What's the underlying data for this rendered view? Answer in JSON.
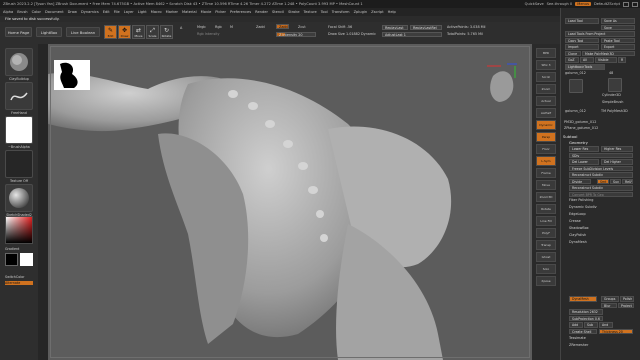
{
  "titlebar": {
    "title": "ZBrush 2023.2.2 [Tyson Yan]   ZBrush Document   • Free Mem 74.675GB • Active Mem 8462 • Scratch Disk 43 • ZTime 10.596 RTime 4.26 Timer 4.272 ATime 1.248 • PolyCount 3.993 MP • MeshCount 1",
    "quicksave": "QuickSave",
    "see_through": "See-through 0",
    "menus": "Menus",
    "default_script": "DefaultZScript"
  },
  "menu": [
    "Alpha",
    "Brush",
    "Color",
    "Document",
    "Draw",
    "Dynamics",
    "Edit",
    "File",
    "Layer",
    "Light",
    "Macro",
    "Marker",
    "Material",
    "Movie",
    "Picker",
    "Preferences",
    "Render",
    "Stencil",
    "Stroke",
    "Texture",
    "Tool",
    "Transform",
    "Zplugin",
    "Zscript",
    "Help"
  ],
  "notice": "File saved to disk successfully.",
  "shelf": {
    "nav": [
      "Home Page",
      "LightBox",
      "Live Boolean"
    ],
    "tools": [
      {
        "icon": "✎",
        "label": "Edit",
        "active": true
      },
      {
        "icon": "✥",
        "label": "Draw",
        "active": true
      },
      {
        "icon": "⇄",
        "label": "Move",
        "active": false
      },
      {
        "icon": "⤢",
        "label": "Scale",
        "active": false
      },
      {
        "icon": "↻",
        "label": "Rotate",
        "active": false
      }
    ],
    "a_label": "A",
    "mrgb": "Mrgb",
    "rgb": "Rgb",
    "m": "M",
    "rgb_intensity": "Rgb Intensity",
    "zadd": "Zadd",
    "zsub": "Zsub",
    "zcut": "Zcut",
    "z_intensity": "Z Intensity 20",
    "z_intensity_value": 20,
    "focal_shift": "Focal Shift -56",
    "draw_size": "Draw Size 1.01882",
    "dynamic": "Dynamic",
    "replay_last": "ReplayLast",
    "replay_last_rel": "ReplayLastRel",
    "adjust_last": "AdjustLast 1",
    "active_points": "ActivePoints: 3.038 Mil",
    "total_points": "TotalPoints: 5.765 Mil"
  },
  "left": {
    "items": [
      {
        "label": "ClayBuildup"
      },
      {
        "label": "FreeHand"
      },
      {
        "label": "~BrushAlpha"
      },
      {
        "label": "Texture Off"
      },
      {
        "label": "SketchShaded2"
      },
      {
        "label": "Gradient"
      },
      {
        "label": "SwitchColor"
      },
      {
        "label": "Alternate"
      }
    ]
  },
  "vptools": [
    "BPR",
    "SPix 3",
    "Scroll",
    "Zoom",
    "Actual",
    "AAHalf",
    "Dynamic",
    "Persp",
    "Floor",
    "L.Sym",
    "Frame",
    "Move",
    "Zoom3D",
    "Rotate",
    "Line Fill",
    "PolyF",
    "Transp",
    "Ghost",
    "Solo",
    "Xpose"
  ],
  "right": {
    "load_tool": "Load Tool",
    "save_as": "Save As",
    "save": "Save",
    "load_tools_from_project": "Load Tools From Project",
    "copy_tool": "Copy Tool",
    "paste_tool": "Paste Tool",
    "import": "Import",
    "export": "Export",
    "clone": "Clone",
    "make_polymesh3d": "Make PolyMesh3D",
    "goz": "GoZ",
    "all": "All",
    "visible": "Visible",
    "r": "R",
    "lightbox_tools": "Lightbox>Tools",
    "current_tool": "golumn_012",
    "current_tool_count": "48",
    "thumbs": [
      "golumn_012",
      "Cylinder3D",
      "SimpleBrush",
      "golumn_012",
      "PM3D_golumn_012",
      "TM PolyMesh3D",
      "ZPlane_golumn_012"
    ],
    "subtool": "Subtool",
    "geometry": "Geometry",
    "lower_res": "Lower Res",
    "higher_res": "Higher Res",
    "sdiv": "SDiv",
    "del_lower": "Del Lower",
    "del_higher": "Del Higher",
    "freeze_subdiv": "Freeze SubDivision Levels",
    "reconstruct_subdiv": "Reconstruct Subdiv",
    "divide": "Divide",
    "smt": "Smt",
    "suv": "Suv",
    "reuv": "ReUV",
    "convert_bpr": "Convert BPR To Geo",
    "edge_loop": "EdgeLoop",
    "crease": "Crease",
    "shadowbox": "ShadowBox",
    "claypolish": "ClayPolish",
    "dynamesh": "DynaMesh",
    "groups": "Groups",
    "polish": "Polish",
    "blur": "Blur",
    "project": "Project",
    "resolution": "Resolution 2632",
    "subprojection": "SubProjection 0.6",
    "add": "Add",
    "sub": "Sub",
    "and": "And",
    "create_shell": "Create Shell",
    "thickness": "Thickness 20",
    "tessimate": "Tessimate",
    "zremesher": "ZRemesher",
    "fiber_polishing": "Fiber Polishing",
    "dynamic_subdiv": "Dynamic Subdiv",
    "tool_label": "Tool"
  }
}
